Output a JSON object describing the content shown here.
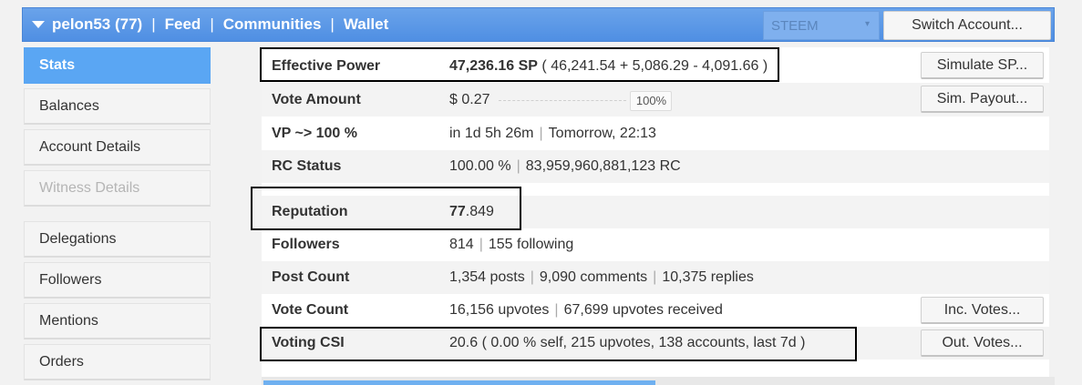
{
  "header": {
    "account": "pelon53 (77)",
    "nav": [
      "Feed",
      "Communities",
      "Wallet"
    ],
    "separator": "|",
    "coin": "STEEM",
    "switch_label": "Switch Account..."
  },
  "sidebar": {
    "items": [
      {
        "label": "Stats",
        "state": "active"
      },
      {
        "label": "Balances",
        "state": "normal"
      },
      {
        "label": "Account Details",
        "state": "normal"
      },
      {
        "label": "Witness Details",
        "state": "disabled"
      },
      {
        "label": "Delegations",
        "state": "normal"
      },
      {
        "label": "Followers",
        "state": "normal"
      },
      {
        "label": "Mentions",
        "state": "normal"
      },
      {
        "label": "Orders",
        "state": "normal"
      }
    ]
  },
  "stats": {
    "effective_power": {
      "label": "Effective Power",
      "value_bold": "47,236.16 SP",
      "value_detail": " ( 46,241.54 + 5,086.29 - 4,091.66 )",
      "action": "Simulate SP..."
    },
    "vote_amount": {
      "label": "Vote Amount",
      "value": "$ 0.27",
      "pct": "100%",
      "pct_value": 100,
      "action": "Sim. Payout..."
    },
    "vp": {
      "label": "VP ~> 100 %",
      "value_a": "in 1d 5h 26m",
      "value_b": "Tomorrow, 22:13"
    },
    "rc": {
      "label": "RC Status",
      "value_a": "100.00 %",
      "value_b": "83,959,960,881,123 RC"
    },
    "reputation": {
      "label": "Reputation",
      "value_bold": "77",
      "value_rest": ".849"
    },
    "followers": {
      "label": "Followers",
      "value_a": "814",
      "value_b": "155 following"
    },
    "post_count": {
      "label": "Post Count",
      "value_a": "1,354 posts",
      "value_b": "9,090 comments",
      "value_c": "10,375 replies"
    },
    "vote_count": {
      "label": "Vote Count",
      "value_a": "16,156 upvotes",
      "value_b": "67,699 upvotes received",
      "action": "Inc. Votes..."
    },
    "voting_csi": {
      "label": "Voting CSI",
      "value": "20.6 ( 0.00 % self, 215 upvotes, 138 accounts, last 7d )",
      "action": "Out. Votes..."
    }
  }
}
